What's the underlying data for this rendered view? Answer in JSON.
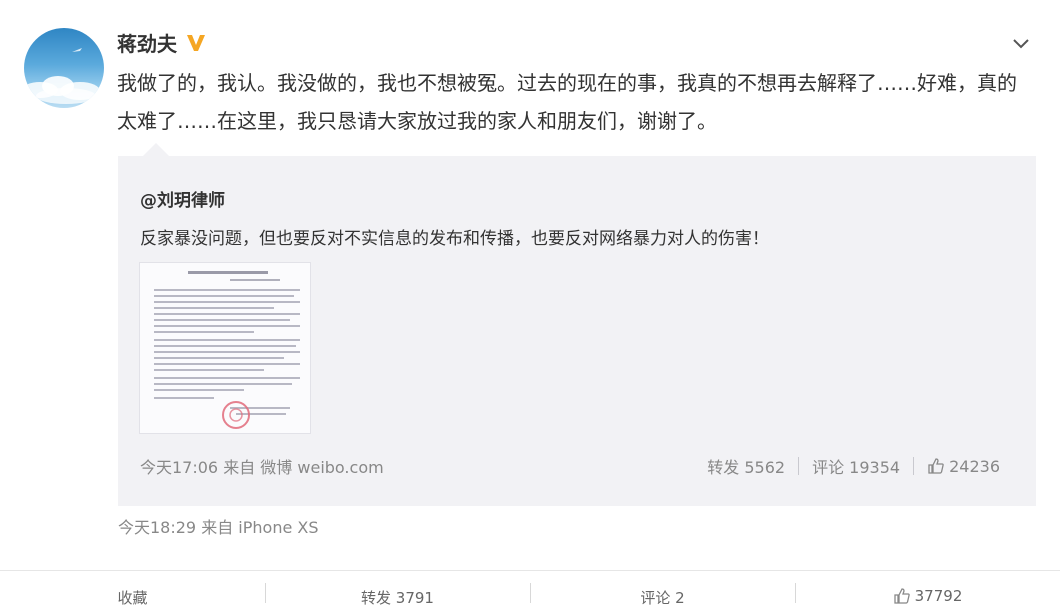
{
  "post": {
    "author": "蒋劲夫",
    "text": "我做了的，我认。我没做的，我也不想被冤。过去的现在的事，我真的不想再去解释了……好难，真的太难了……在这里，我只恳请大家放过我的家人和朋友们，谢谢了。",
    "time": "今天18:29",
    "source": "来自 iPhone XS"
  },
  "retweet": {
    "author": "@刘玥律师",
    "text": "反家暴没问题，但也要反对不实信息的发布和传播，也要反对网络暴力对人的伤害！",
    "time": "今天17:06",
    "source": "来自 微博 weibo.com",
    "repost": "转发 5562",
    "comment": "评论 19354",
    "likes": "24236"
  },
  "actions": {
    "favorite": "收藏",
    "repost": "转发 3791",
    "comment": "评论 2",
    "likes": "37792"
  },
  "colors": {
    "verified_badge": "#f5a623",
    "retweet_bg": "#f2f2f5",
    "meta_text": "#888888"
  },
  "icons": {
    "verified": "verified-v-icon",
    "menu": "chevron-down-icon",
    "like": "thumbs-up-icon"
  }
}
